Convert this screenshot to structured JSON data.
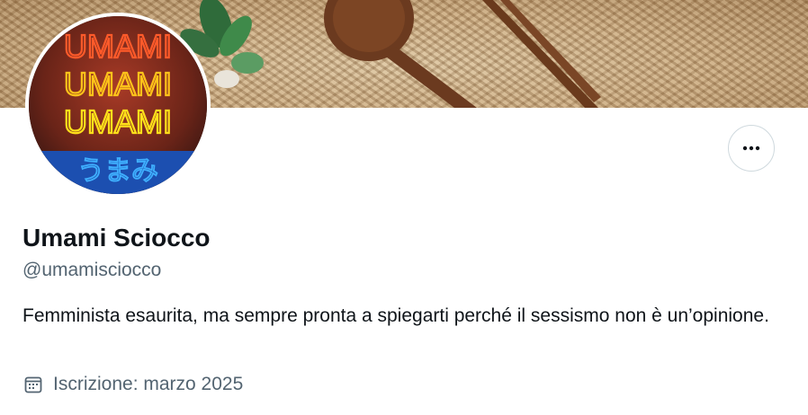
{
  "banner": {
    "description_icon": "banner-image"
  },
  "profile": {
    "display_name": "Umami Sciocco",
    "handle": "@umamisciocco",
    "bio": "Femminista esaurita, ma sempre pronta a spiegarti perché il sessismo non è un’opinione.",
    "joined": "Iscrizione: marzo 2025"
  },
  "avatar": {
    "neon_lines": [
      "UMAMI",
      "UMAMI",
      "UMAMI"
    ],
    "neon_kana": "うまみ"
  },
  "icons": {
    "more": "more-horizontal-icon",
    "calendar": "calendar-icon"
  },
  "colors": {
    "text_primary": "#0f1419",
    "text_secondary": "#536471",
    "border": "#cfd9de",
    "neon_red": "#ff3b1f",
    "neon_yellow": "#ffd400",
    "neon_blue": "#1e90ff"
  }
}
